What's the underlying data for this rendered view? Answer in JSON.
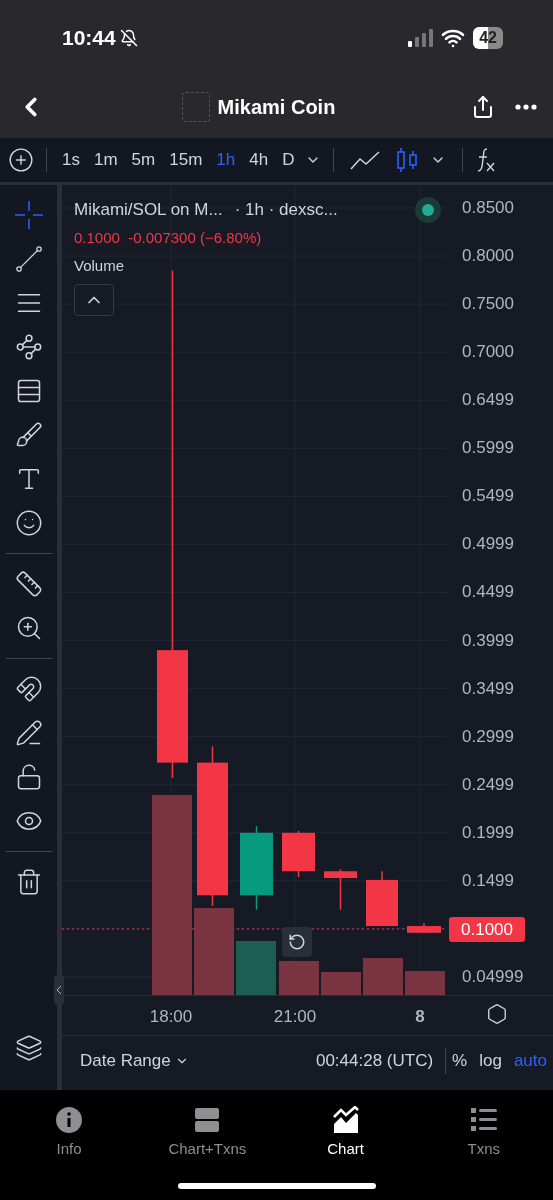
{
  "status_bar": {
    "time": "10:44",
    "battery": "42"
  },
  "header": {
    "title": "Mikami Coin"
  },
  "toolbar": {
    "intervals": [
      {
        "label": "1s",
        "selected": false
      },
      {
        "label": "1m",
        "selected": false
      },
      {
        "label": "5m",
        "selected": false
      },
      {
        "label": "15m",
        "selected": false
      },
      {
        "label": "1h",
        "selected": true
      },
      {
        "label": "4h",
        "selected": false
      },
      {
        "label": "D",
        "selected": false
      }
    ],
    "chart_types": [
      {
        "kind": "line",
        "selected": false
      },
      {
        "kind": "candles",
        "selected": true
      }
    ]
  },
  "legend": {
    "symbol": "Mikami/SOL on M...",
    "details": "· 1h · dexsc...",
    "quote": "0.1000  -0.007300 (−6.80%)",
    "volume_label": "Volume"
  },
  "price_scale": [
    "0.8500",
    "0.8000",
    "0.7500",
    "0.7000",
    "0.6499",
    "0.5999",
    "0.5499",
    "0.4999",
    "0.4499",
    "0.3999",
    "0.3499",
    "0.2999",
    "0.2499",
    "0.1999",
    "0.1499",
    "0.04999"
  ],
  "current_price": "0.1000",
  "candles": [
    {
      "color": "#f23645"
    },
    {
      "color": "#f23645"
    },
    {
      "color": "#089981"
    },
    {
      "color": "#f23645"
    },
    {
      "color": "#f23645"
    },
    {
      "color": "#f23645"
    },
    {
      "color": "#f23645"
    }
  ],
  "volume_bars": [
    {
      "color": "#7a3441"
    },
    {
      "color": "#7a3441"
    },
    {
      "color": "#1d5e52"
    },
    {
      "color": "#7a3441"
    },
    {
      "color": "#7a3441"
    },
    {
      "color": "#7a3441"
    },
    {
      "color": "#7a3441"
    }
  ],
  "time_axis": [
    "18:00",
    "21:00",
    "8"
  ],
  "bottom_bar": {
    "date_range": "Date Range",
    "clock": "00:44:28 (UTC)",
    "options": [
      {
        "label": "%",
        "selected": false
      },
      {
        "label": "log",
        "selected": false
      },
      {
        "label": "auto",
        "selected": true
      }
    ]
  },
  "tab_bar": [
    {
      "label": "Info",
      "selected": false
    },
    {
      "label": "Chart+Txns",
      "selected": false
    },
    {
      "label": "Chart",
      "selected": true
    },
    {
      "label": "Txns",
      "selected": false
    }
  ]
}
